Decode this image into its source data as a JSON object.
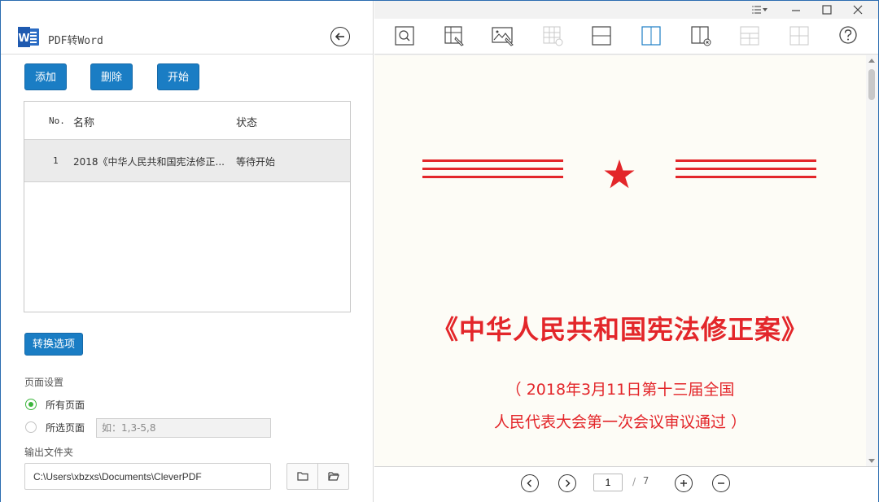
{
  "app": {
    "title": "PDF转Word",
    "logo": "word-icon",
    "accent_color": "#1a7dc4"
  },
  "actions": {
    "add_label": "添加",
    "delete_label": "删除",
    "start_label": "开始",
    "options_label": "转换选项"
  },
  "file_table": {
    "columns": [
      "No.",
      "名称",
      "状态"
    ],
    "rows": [
      {
        "no": "1",
        "name": "2018《中华人民共和国宪法修正...",
        "status": "等待开始"
      }
    ]
  },
  "page_settings": {
    "label": "页面设置",
    "all_pages_label": "所有页面",
    "selected_pages_label": "所选页面",
    "range_placeholder": "如：1,3-5,8",
    "selected_option": "all"
  },
  "output": {
    "label": "输出文件夹",
    "path": "C:\\Users\\xbzxs\\Documents\\CleverPDF"
  },
  "toolbar": {
    "tools": [
      "zoom-area-icon",
      "select-text-icon",
      "select-image-icon",
      "table-delete-icon",
      "horizontal-line-icon",
      "vertical-line-icon",
      "column-delete-icon",
      "header-split-icon",
      "grid-icon",
      "help-icon"
    ]
  },
  "document": {
    "title": "《中华人民共和国宪法修正案》",
    "subtitle_line1": "（ 2018年3月11日第十三届全国",
    "subtitle_line2": "人民代表大会第一次会议审议通过 ）",
    "color": "#e3262a"
  },
  "pager": {
    "current_page": "1",
    "separator": "/",
    "total_pages": "7"
  }
}
